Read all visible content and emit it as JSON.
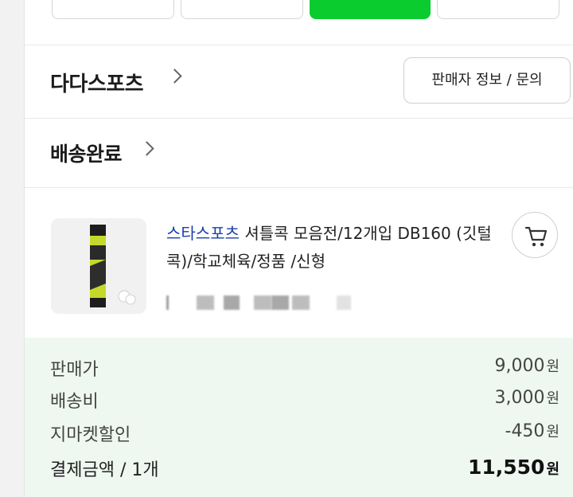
{
  "seller": {
    "name": "다다스포츠",
    "info_button": "판매자 정보 / 문의"
  },
  "order": {
    "status": "배송완료"
  },
  "item": {
    "brand": "스타스포츠",
    "title": " 셔틀콕 모음전/12개입 DB160 (깃털콕)/학교체육/정품 /신형"
  },
  "price": {
    "rows": [
      {
        "label": "판매가",
        "value": "9,000",
        "unit": "원"
      },
      {
        "label": "배송비",
        "value": "3,000",
        "unit": "원"
      },
      {
        "label": "지마켓할인",
        "value": "-450",
        "unit": "원"
      },
      {
        "label": "결제금액 / 1개",
        "value": "11,550",
        "unit": "원"
      }
    ]
  },
  "colors": {
    "accent": "#0acc2e",
    "brand_link": "#1a3fa8",
    "price_bg": "#eef8f1"
  }
}
